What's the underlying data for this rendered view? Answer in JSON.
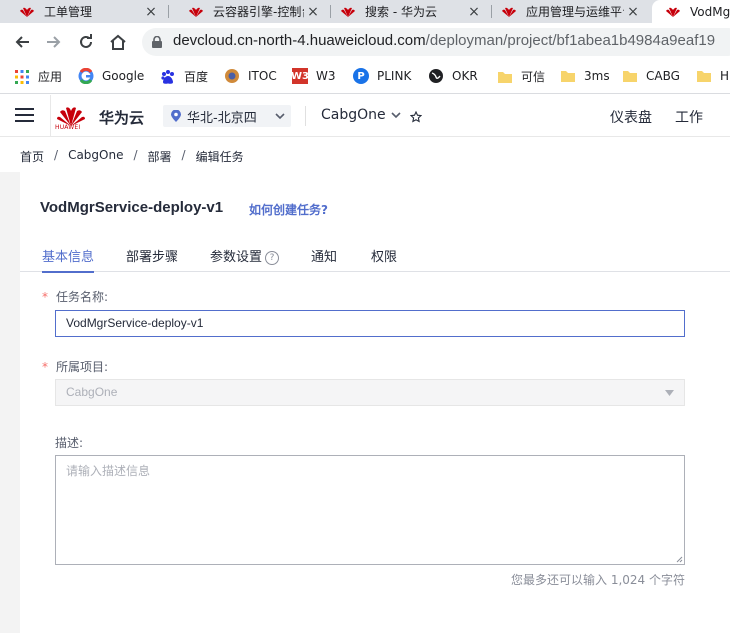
{
  "browser": {
    "tabs": [
      {
        "title": "工单管理",
        "active": false
      },
      {
        "title": "云容器引擎-控制台",
        "active": false
      },
      {
        "title": "搜索 - 华为云",
        "active": false
      },
      {
        "title": "应用管理与运维平台",
        "active": false
      },
      {
        "title": "VodMg",
        "active": true
      }
    ],
    "close_glyph": "×",
    "url_host": "devcloud.cn-north-4.huaweicloud.com",
    "url_path": "/deployman/project/bf1abea1b4984a9eaf19",
    "bookmarks": [
      {
        "label": "应用",
        "icon": "apps-grid-icon"
      },
      {
        "label": "Google",
        "icon": "google-icon"
      },
      {
        "label": "百度",
        "icon": "baidu-icon"
      },
      {
        "label": "ITOC",
        "icon": "itoc-icon"
      },
      {
        "label": "W3",
        "icon": "w3-icon"
      },
      {
        "label": "PLINK",
        "icon": "plink-icon"
      },
      {
        "label": "OKR",
        "icon": "globe-icon"
      },
      {
        "label": "可信",
        "icon": "folder-icon"
      },
      {
        "label": "3ms",
        "icon": "folder-icon"
      },
      {
        "label": "CABG",
        "icon": "folder-icon"
      },
      {
        "label": "HI",
        "icon": "folder-icon"
      }
    ]
  },
  "header": {
    "logo_text": "HUAWEI",
    "brand": "华为云",
    "region": "华北-北京四",
    "project": "CabgOne",
    "links": [
      "仪表盘",
      "工作"
    ]
  },
  "breadcrumb": [
    "首页",
    "CabgOne",
    "部署",
    "编辑任务"
  ],
  "page": {
    "title": "VodMgrService-deploy-v1",
    "help_link": "如何创建任务?",
    "tabs": [
      "基本信息",
      "部署步骤",
      "参数设置",
      "通知",
      "权限"
    ],
    "help_glyph": "?",
    "active_tab": 0
  },
  "form": {
    "required_mark": "*",
    "task_name_label": "任务名称:",
    "task_name_value": "VodMgrService-deploy-v1",
    "project_label": "所属项目:",
    "project_value": "CabgOne",
    "desc_label": "描述:",
    "desc_placeholder": "请输入描述信息",
    "char_hint": "您最多还可以输入 1,024 个字符"
  },
  "colors": {
    "accent": "#526ecc",
    "brand_red": "#c7000b",
    "required": "#f66f6a"
  }
}
